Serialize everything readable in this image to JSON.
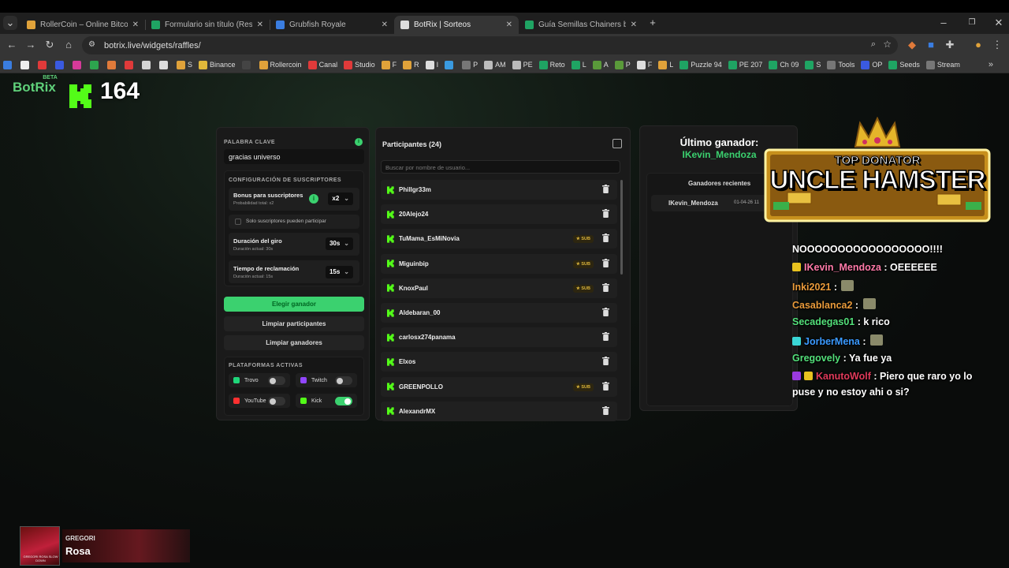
{
  "tabs": [
    {
      "title": "RollerCoin – Online Bitcoin Mi",
      "color": "#e0a23a",
      "active": false
    },
    {
      "title": "Formulario sin título (Respuest",
      "color": "#1fa463",
      "active": false
    },
    {
      "title": "Grubfish Royale",
      "color": "#3a7de0",
      "active": false
    },
    {
      "title": "BotRix | Sorteos",
      "color": "#dddddd",
      "active": true
    },
    {
      "title": "Guía Semillas Chainers by Pier",
      "color": "#1fa463",
      "active": false
    }
  ],
  "tab_close": "✕",
  "new_tab": "+",
  "url": "botrix.live/widgets/raffles/",
  "bookmarks": [
    {
      "label": "",
      "color": "#3a7de0"
    },
    {
      "label": "",
      "color": "#eee"
    },
    {
      "label": "",
      "color": "#e03a3a"
    },
    {
      "label": "",
      "color": "#3a5ae0"
    },
    {
      "label": "",
      "color": "#d63a9a"
    },
    {
      "label": "",
      "color": "#2da44e"
    },
    {
      "label": "",
      "color": "#e07a3a"
    },
    {
      "label": "",
      "color": "#e03a3a"
    },
    {
      "label": "",
      "color": "#d5d5d5"
    },
    {
      "label": "",
      "color": "#ddd"
    },
    {
      "label": "S",
      "color": "#e0a23a"
    },
    {
      "label": "Binance",
      "color": "#e0b83a"
    },
    {
      "label": "",
      "color": "#444"
    },
    {
      "label": "Rollercoin",
      "color": "#e0a23a"
    },
    {
      "label": "Canal",
      "color": "#e03a3a"
    },
    {
      "label": "Studio",
      "color": "#e03a3a"
    },
    {
      "label": "F",
      "color": "#e0a23a"
    },
    {
      "label": "R",
      "color": "#e0a23a"
    },
    {
      "label": "I",
      "color": "#ddd"
    },
    {
      "label": "",
      "color": "#3a9ae0"
    },
    {
      "label": "P",
      "color": "#777"
    },
    {
      "label": "AM",
      "color": "#bbb"
    },
    {
      "label": "PE",
      "color": "#bbb"
    },
    {
      "label": "Reto",
      "color": "#1fa463"
    },
    {
      "label": "L",
      "color": "#1fa463"
    },
    {
      "label": "A",
      "color": "#5a9a3a"
    },
    {
      "label": "P",
      "color": "#5a9a3a"
    },
    {
      "label": "F",
      "color": "#ddd"
    },
    {
      "label": "L",
      "color": "#e0a23a"
    },
    {
      "label": "Puzzle 94",
      "color": "#1fa463"
    },
    {
      "label": "PE 207",
      "color": "#1fa463"
    },
    {
      "label": "Ch 09",
      "color": "#1fa463"
    },
    {
      "label": "S",
      "color": "#1fa463"
    },
    {
      "label": "Tools",
      "color": "#777"
    },
    {
      "label": "OP",
      "color": "#3a5ae0"
    },
    {
      "label": "Seeds",
      "color": "#1fa463"
    },
    {
      "label": "Stream",
      "color": "#777"
    }
  ],
  "bookmarks_more": "»",
  "overlay": {
    "brand": "BotRix",
    "beta": "BETA",
    "viewer_count": "164",
    "accent": "#53fc18"
  },
  "left": {
    "keyword_label": "PALABRA CLAVE",
    "keyword_value": "gracias universo",
    "subs_config_label": "CONFIGURACIÓN DE SUSCRIPTORES",
    "bonus_title": "Bonus para suscriptores",
    "bonus_sub": "Probabilidad total: x2",
    "bonus_value": "x2",
    "only_subs": "Solo suscriptores pueden participar",
    "spin_title": "Duración del giro",
    "spin_sub": "Duración actual: 30s",
    "spin_value": "30s",
    "claim_title": "Tiempo de reclamación",
    "claim_sub": "Duración actual: 15s",
    "claim_value": "15s",
    "btn_pick": "Elegir ganador",
    "btn_clear_participants": "Limpiar participantes",
    "btn_clear_winners": "Limpiar ganadores",
    "platforms_label": "PLATAFORMAS ACTIVAS",
    "platforms": [
      {
        "name": "Trovo",
        "color": "#1fd67a",
        "on": false
      },
      {
        "name": "Twitch",
        "color": "#9146ff",
        "on": false
      },
      {
        "name": "YouTube",
        "color": "#ff3030",
        "on": false
      },
      {
        "name": "Kick",
        "color": "#53fc18",
        "on": true
      }
    ]
  },
  "mid": {
    "title": "Participantes (24)",
    "search_placeholder": "Buscar por nombre de usuario...",
    "sub_badge": "SUB",
    "participants": [
      {
        "name": "Phillgr33m",
        "sub": false
      },
      {
        "name": "20Alejo24",
        "sub": false
      },
      {
        "name": "TuMama_EsMiNovia",
        "sub": true
      },
      {
        "name": "Miguinbip",
        "sub": true
      },
      {
        "name": "KnoxPaul",
        "sub": true
      },
      {
        "name": "Aldebaran_00",
        "sub": false
      },
      {
        "name": "carlosx274panama",
        "sub": false
      },
      {
        "name": "Elxos",
        "sub": false
      },
      {
        "name": "GREENPOLLO",
        "sub": true
      },
      {
        "name": "AlexandrMX",
        "sub": false
      }
    ]
  },
  "right": {
    "last_winner_label": "Último ganador:",
    "last_winner": "IKevin_Mendoza",
    "recent_label": "Ganadores recientes",
    "recent": [
      {
        "name": "IKevin_Mendoza",
        "date": "01-04-26 11"
      }
    ]
  },
  "banner": {
    "top": "TOP DONATOR",
    "name": "UNCLE HAMSTER"
  },
  "chat": [
    {
      "user": "",
      "text": "NOOOOOOOOOOOOOOOOO!!!!",
      "color": "#ffffff",
      "badges": []
    },
    {
      "user": "IKevin_Mendoza",
      "text": ": OEEEEEE",
      "color": "#ff7aa8",
      "badges": [
        "#e8c21f"
      ]
    },
    {
      "user": "Inki2021",
      "text": ": ",
      "color": "#e89a3a",
      "badges": []
    },
    {
      "user": "Casablanca2",
      "text": ": ",
      "color": "#e89a3a",
      "badges": []
    },
    {
      "user": "Secadegas01",
      "text": ": k rico",
      "color": "#53e07a",
      "badges": []
    },
    {
      "user": "JorberMena",
      "text": ": ",
      "color": "#3a9aff",
      "badges": [
        "#3ad6d6"
      ]
    },
    {
      "user": "Gregovely",
      "text": ": Ya fue ya",
      "color": "#53e07a",
      "badges": []
    },
    {
      "user": "KanutoWolf",
      "text": ": Piero que raro yo lo",
      "color": "#e03a5a",
      "badges": [
        "#9a3ae0",
        "#e8c21f"
      ]
    },
    {
      "user": "",
      "text": "puse y no estoy ahi o si?",
      "color": "#ffffff",
      "badges": []
    }
  ],
  "now_playing": {
    "artist": "GREGORI",
    "song": "Rosa",
    "cover_text": "GREGORI ROSA SLOW DOWN"
  }
}
